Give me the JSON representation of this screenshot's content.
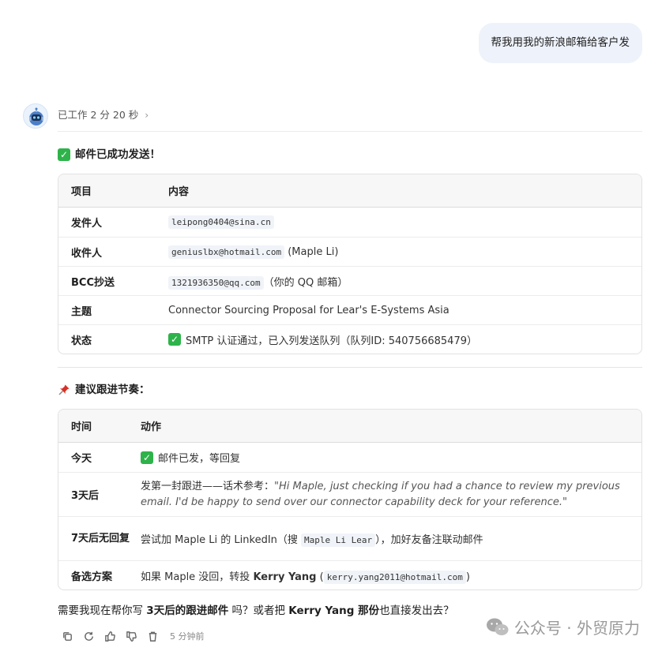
{
  "user_message": "帮我用我的新浪邮箱给客户发",
  "status": {
    "worked": "已工作 2 分 20 秒",
    "chevron": "›"
  },
  "sent": {
    "title": "邮件已成功发送！",
    "table": {
      "headers": [
        "项目",
        "内容"
      ],
      "rows": [
        {
          "label": "发件人",
          "code": "leipong0404@sina.cn",
          "text": ""
        },
        {
          "label": "收件人",
          "code": "geniuslbx@hotmail.com",
          "text": " (Maple Li)"
        },
        {
          "label": "BCC抄送",
          "code": "1321936350@qq.com",
          "text": "（你的 QQ 邮箱）"
        },
        {
          "label": "主题",
          "code": "",
          "text": "Connector Sourcing Proposal for Lear's E-Systems Asia"
        },
        {
          "label": "状态",
          "code": "",
          "text": "SMTP 认证通过，已入列发送队列（队列ID: 540756685479）"
        }
      ]
    }
  },
  "followup": {
    "title": "建议跟进节奏：",
    "table": {
      "headers": [
        "时间",
        "动作"
      ],
      "rows": [
        {
          "label": "今天",
          "text": "邮件已发，等回复"
        },
        {
          "label": "3天后",
          "prefix": "发第一封跟进——话术参考：",
          "quote": "\"Hi Maple, just checking if you had a chance to review my previous email. I'd be happy to send over our connector capability deck for your reference.\""
        },
        {
          "label": "7天后无回复",
          "before": "尝试加 Maple Li 的 LinkedIn（搜 ",
          "code": "Maple Li Lear",
          "after": "），加好友备注联动邮件"
        },
        {
          "label": "备选方案",
          "before": "如果 Maple 没回，转投 ",
          "bold": "Kerry Yang",
          "mid": " (",
          "code": "kerry.yang2011@hotmail.com",
          "after": ")"
        }
      ]
    }
  },
  "question": {
    "p1": "需要我现在帮你写 ",
    "b1": "3天后的跟进邮件",
    "p2": " 吗？或者把 ",
    "b2": "Kerry Yang 那份",
    "p3": "也直接发出去？"
  },
  "actions": {
    "icons": [
      "copy-icon",
      "retry-icon",
      "thumbs-up-icon",
      "thumbs-down-icon",
      "trash-icon"
    ],
    "time": "5 分钟前"
  },
  "watermark": "公众号 · 外贸原力",
  "colors": {
    "bubble": "#eef2fb",
    "check": "#2eb34a",
    "pin": "#d93025"
  }
}
